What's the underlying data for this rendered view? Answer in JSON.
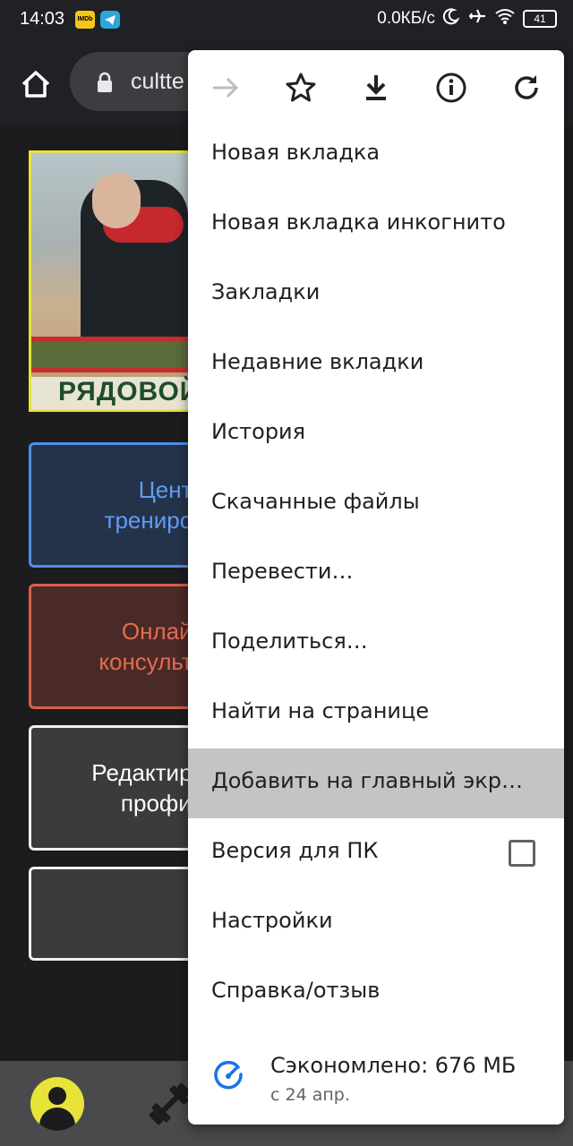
{
  "status_bar": {
    "time": "14:03",
    "imdb_label": "IMDb",
    "net_speed": "0.0КБ/с",
    "battery": "41"
  },
  "toolbar": {
    "url": "cultte"
  },
  "page": {
    "banner_word": "РЯДОВОЙ",
    "cards": [
      {
        "line1": "Центр",
        "line2": "трениров"
      },
      {
        "line1": "Онлайн",
        "line2": "консульта"
      },
      {
        "line1": "Редактиро",
        "line2": "профил"
      }
    ]
  },
  "menu": {
    "icons": [
      "forward-icon",
      "star-icon",
      "download-icon",
      "info-icon",
      "reload-icon"
    ],
    "items": [
      {
        "label": "Новая вкладка"
      },
      {
        "label": "Новая вкладка инкогнито"
      },
      {
        "label": "Закладки"
      },
      {
        "label": "Недавние вкладки"
      },
      {
        "label": "История"
      },
      {
        "label": "Скачанные файлы"
      },
      {
        "label": "Перевести…"
      },
      {
        "label": "Поделиться…"
      },
      {
        "label": "Найти на странице"
      },
      {
        "label": "Добавить на главный экр…",
        "highlighted": true
      },
      {
        "label": "Версия для ПК",
        "checkbox": false
      },
      {
        "label": "Настройки"
      },
      {
        "label": "Справка/отзыв"
      }
    ],
    "savings": {
      "main": "Сэкономлено: 676 МБ",
      "sub": "с 24 апр."
    }
  },
  "colors": {
    "accent_blue": "#4f8ee8",
    "accent_red": "#d8604a",
    "brand_yellow": "#e8e33a",
    "menu_highlight": "#c4c4c4"
  }
}
